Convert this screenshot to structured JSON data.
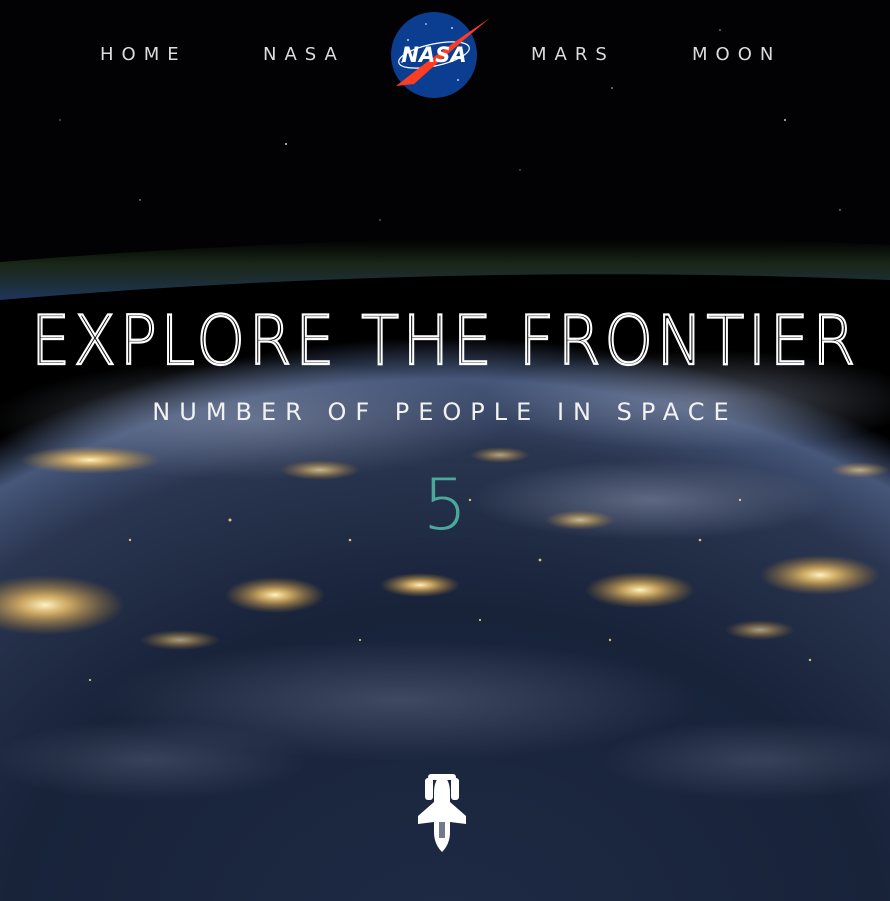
{
  "nav": {
    "links": [
      "HOME",
      "NASA",
      "MARS",
      "MOON"
    ],
    "logo_text": "NASA"
  },
  "hero": {
    "title": "EXPLORE THE FRONTIER",
    "subtitle": "NUMBER OF PEOPLE IN SPACE",
    "people_count": "5"
  },
  "colors": {
    "accent": "#4aa89d",
    "nav_text": "#dcdcdc",
    "background": "#000000",
    "logo_blue": "#0b3d91",
    "logo_red": "#fc3d21"
  },
  "icons": {
    "logo": "nasa-meatball-logo",
    "scroll": "space-shuttle-icon"
  }
}
